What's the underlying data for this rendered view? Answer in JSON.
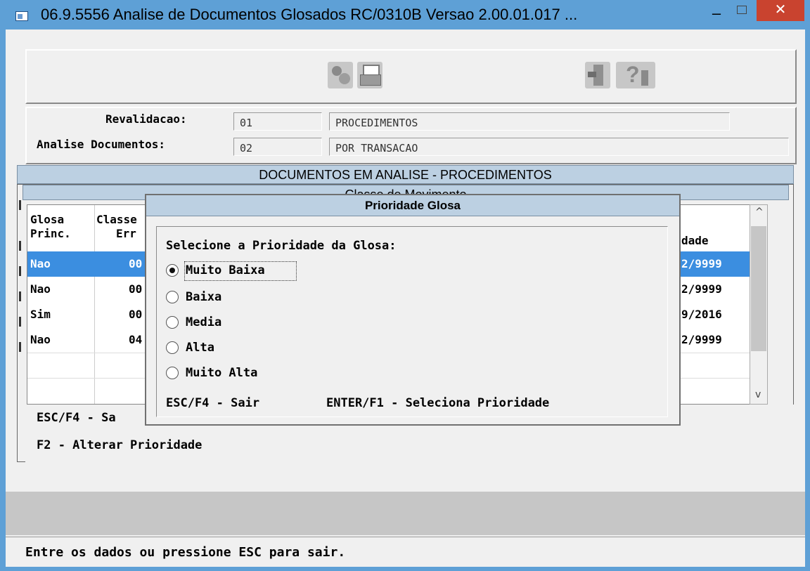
{
  "window": {
    "title": "06.9.5556   Analise  de Documentos Glosados RC/0310B Versao 2.00.01.017 ...",
    "minimize_label": "–",
    "close_label": "✕"
  },
  "toolbar": {
    "icons": [
      "tools-icon",
      "print-icon",
      "exit-icon",
      "help-icon"
    ]
  },
  "header": {
    "revalidacao_label": "Revalidacao:",
    "revalidacao_code": "01",
    "revalidacao_desc": "PROCEDIMENTOS",
    "analise_label": "Analise Documentos:",
    "analise_code": "02",
    "analise_desc": "POR TRANSACAO"
  },
  "documents": {
    "title": "DOCUMENTOS EM ANALISE - PROCEDIMENTOS",
    "classe_title": "Classe de Movimento",
    "columns": {
      "glosa": "Glosa",
      "princ": "Princ.",
      "classe": "Classe",
      "err": "Err",
      "validade": "dade"
    },
    "rows": [
      {
        "glosa": "Nao",
        "classe": "00",
        "validade": "2/9999",
        "selected": true
      },
      {
        "glosa": "Nao",
        "classe": "00",
        "validade": "2/9999",
        "selected": false
      },
      {
        "glosa": "Sim",
        "classe": "00",
        "validade": "9/2016",
        "selected": false
      },
      {
        "glosa": "Nao",
        "classe": "04",
        "validade": "2/9999",
        "selected": false
      }
    ]
  },
  "help": {
    "esc": "ESC/F4 - Sa",
    "f2": "F2 - Alterar Prioridade"
  },
  "dialog": {
    "title": "Prioridade Glosa",
    "prompt": "Selecione a Prioridade da Glosa:",
    "options": [
      "Muito Baixa",
      "Baixa",
      "Media",
      "Alta",
      "Muito Alta"
    ],
    "selected_index": 0,
    "footer_esc": "ESC/F4 - Sair",
    "footer_enter": "ENTER/F1 - Seleciona Prioridade"
  },
  "status": {
    "text": "Entre os dados ou pressione ESC para sair."
  }
}
